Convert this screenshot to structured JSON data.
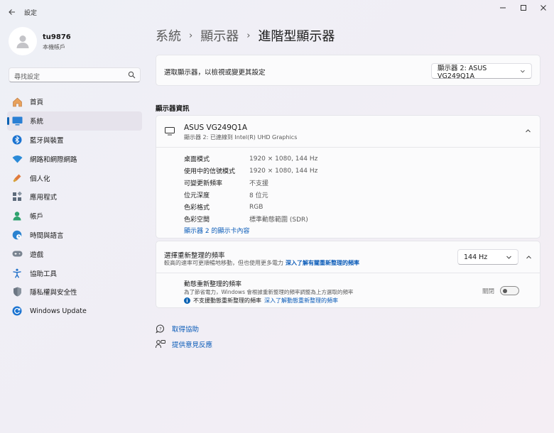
{
  "window": {
    "title": "設定"
  },
  "user": {
    "name": "tu9876",
    "account_type": "本機帳戶"
  },
  "search": {
    "placeholder": "尋找設定"
  },
  "nav": {
    "items": [
      {
        "label": "首頁",
        "icon": "home-icon"
      },
      {
        "label": "系統",
        "icon": "system-icon",
        "active": true
      },
      {
        "label": "藍牙與裝置",
        "icon": "bluetooth-icon"
      },
      {
        "label": "網路和網際網路",
        "icon": "wifi-icon"
      },
      {
        "label": "個人化",
        "icon": "personalization-icon"
      },
      {
        "label": "應用程式",
        "icon": "apps-icon"
      },
      {
        "label": "帳戶",
        "icon": "account-icon"
      },
      {
        "label": "時間與語言",
        "icon": "globe-clock-icon"
      },
      {
        "label": "遊戲",
        "icon": "gamepad-icon"
      },
      {
        "label": "協助工具",
        "icon": "accessibility-icon"
      },
      {
        "label": "隱私權與安全性",
        "icon": "shield-icon"
      },
      {
        "label": "Windows Update",
        "icon": "windows-update-icon"
      }
    ]
  },
  "breadcrumb": {
    "level1": "系統",
    "level2": "顯示器",
    "current": "進階型顯示器"
  },
  "display_select": {
    "label": "選取顯示器，以檢視或變更其設定",
    "value": "顯示器 2: ASUS VG249Q1A"
  },
  "info_section": {
    "title": "顯示器資訊",
    "monitor_name": "ASUS VG249Q1A",
    "monitor_sub": "顯示器 2: 已連線到 Intel(R) UHD Graphics",
    "rows": [
      {
        "key": "桌面模式",
        "value": "1920 × 1080, 144 Hz"
      },
      {
        "key": "使用中的信號模式",
        "value": "1920 × 1080, 144 Hz"
      },
      {
        "key": "可變更新頻率",
        "value": "不支援"
      },
      {
        "key": "位元深度",
        "value": "8 位元"
      },
      {
        "key": "色彩格式",
        "value": "RGB"
      },
      {
        "key": "色彩空間",
        "value": "標準動態範圍 (SDR)"
      }
    ],
    "adapter_link": "顯示器 2 的顯示卡內容"
  },
  "refresh_rate": {
    "title": "選擇重新整理的頻率",
    "desc": "較高的速率可更順暢地移動，但也使用更多電力",
    "desc_link": "深入了解有關重新整理的頻率",
    "value": "144 Hz",
    "dynamic_title": "動態重新整理的頻率",
    "dynamic_desc": "為了節省電力，Windows 會根據重新整理的頻率調整為上方選取的頻率",
    "dynamic_note": "不支援動態重新整理的頻率",
    "dynamic_note_link": "深入了解動態重新整理的頻率",
    "toggle_label": "關閉",
    "toggle_on": false
  },
  "footer": {
    "help": "取得協助",
    "feedback": "提供意見反應"
  },
  "colors": {
    "accent": "#0a62b3",
    "link": "#0a5bb8"
  }
}
